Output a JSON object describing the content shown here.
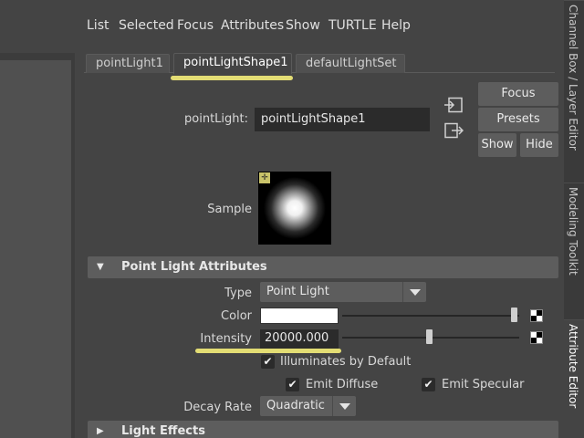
{
  "menu": [
    "List",
    "Selected",
    "Focus",
    "Attributes",
    "Show",
    "TURTLE",
    "Help"
  ],
  "tabs": [
    "pointLight1",
    "pointLightShape1",
    "defaultLightSet"
  ],
  "node": {
    "label": "pointLight:",
    "value": "pointLightShape1"
  },
  "side_buttons": {
    "focus": "Focus",
    "presets": "Presets",
    "show": "Show",
    "hide": "Hide"
  },
  "sample": {
    "label": "Sample"
  },
  "section_point_light": "Point Light Attributes",
  "type": {
    "label": "Type",
    "value": "Point Light"
  },
  "color": {
    "label": "Color",
    "swatch": "#ffffff",
    "slider_fraction": 1.0
  },
  "intensity": {
    "label": "Intensity",
    "value": "20000.000"
  },
  "checks": {
    "illuminates": "Illuminates by Default",
    "emit_diffuse": "Emit Diffuse",
    "emit_specular": "Emit Specular"
  },
  "decay": {
    "label": "Decay Rate",
    "value": "Quadratic"
  },
  "section_light_effects": "Light Effects",
  "dock_tabs": [
    "Channel Box / Layer Editor",
    "Modeling Toolkit",
    "Attribute Editor"
  ],
  "highlight_color": "#f5ee7a"
}
